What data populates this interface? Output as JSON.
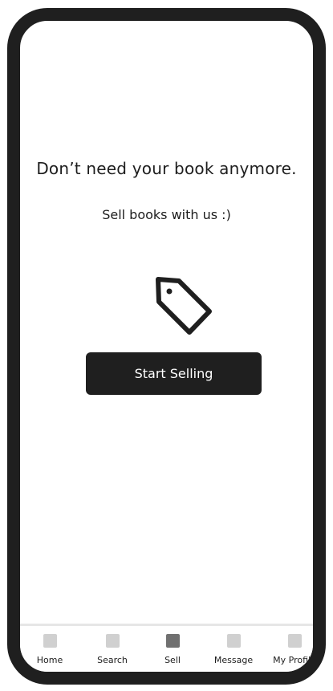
{
  "main": {
    "headline": "Don’t need your book anymore.",
    "subline": "Sell books with us :)",
    "icon": "price-tag-icon",
    "start_button_label": "Start Selling"
  },
  "tabbar": {
    "items": [
      {
        "label": "Home",
        "icon": "home-tab-icon",
        "active": false
      },
      {
        "label": "Search",
        "icon": "search-tab-icon",
        "active": false
      },
      {
        "label": "Sell",
        "icon": "sell-tab-icon",
        "active": true
      },
      {
        "label": "Message",
        "icon": "message-tab-icon",
        "active": false
      },
      {
        "label": "My Profile",
        "icon": "profile-tab-icon",
        "active": false
      }
    ]
  },
  "colors": {
    "frame": "#1f1f1f",
    "button": "#1f1f1f",
    "tab_inactive": "#d0d0d0",
    "tab_active": "#707070"
  }
}
